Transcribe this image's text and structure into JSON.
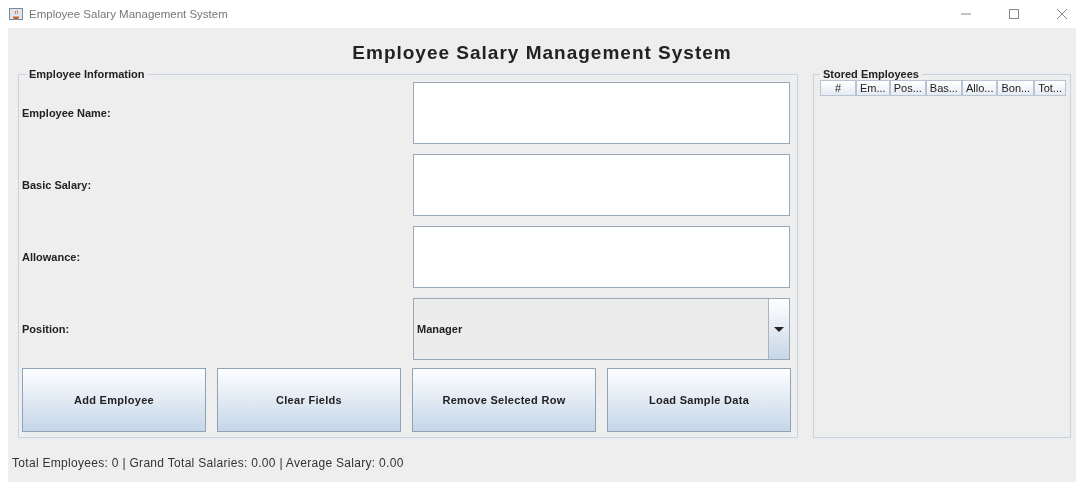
{
  "window": {
    "title": "Employee Salary Management System"
  },
  "heading": "Employee Salary Management System",
  "employee_info": {
    "title": "Employee Information",
    "fields": [
      {
        "label": "Employee Name:",
        "kind": "text"
      },
      {
        "label": "Basic Salary:",
        "kind": "text"
      },
      {
        "label": "Allowance:",
        "kind": "text"
      },
      {
        "label": "Position:",
        "kind": "dropdown",
        "value": "Manager"
      }
    ],
    "buttons": [
      "Add Employee",
      "Clear Fields",
      "Remove Selected Row",
      "Load Sample Data"
    ]
  },
  "stored_employees": {
    "title": "Stored Employees",
    "columns": [
      "#",
      "Em...",
      "Pos...",
      "Bas...",
      "Allo...",
      "Bon...",
      "Tot..."
    ]
  },
  "status_bar": "Total Employees: 0 | Grand Total Salaries: 0.00 | Average Salary: 0.00"
}
